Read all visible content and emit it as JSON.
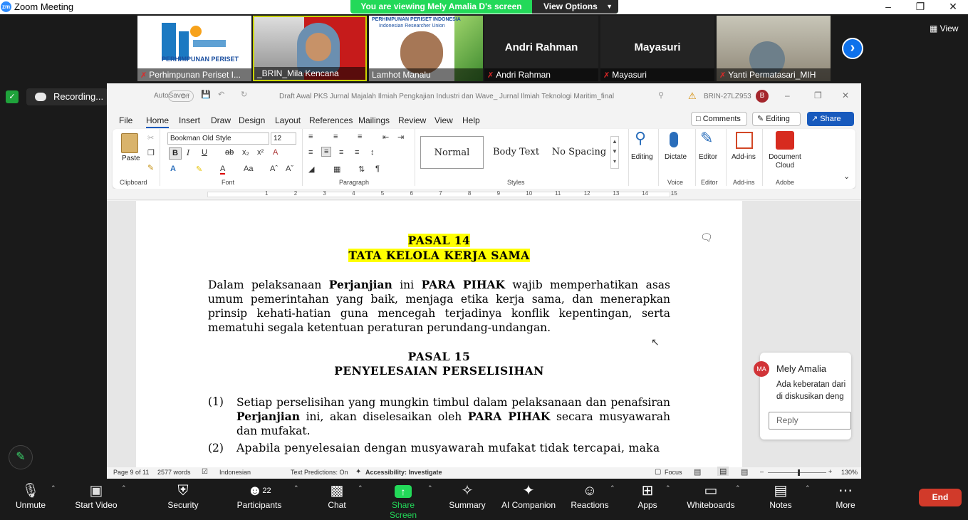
{
  "app": {
    "title": "Zoom Meeting",
    "logo": "zm"
  },
  "banner": {
    "message": "You are viewing Mely Amalia D's screen",
    "view_options": "View Options"
  },
  "gallery": {
    "view_label": "View",
    "tiles": [
      {
        "name": "Perhimpunan Periset I...",
        "logo_text": "PERHIMPUNAN PERISET"
      },
      {
        "name": "_BRIN_Mila Kencana"
      },
      {
        "name": "Lamhot Manalu",
        "logo_text": "PERHIMPUNAN PERISET INDONESIA",
        "logo_sub": "Indonesian Researcher Union"
      },
      {
        "name": "Andri Rahman",
        "big": "Andri Rahman"
      },
      {
        "name": "Mayasuri",
        "big": "Mayasuri"
      },
      {
        "name": "Yanti Permatasari_MIH"
      }
    ]
  },
  "recording": {
    "label": "Recording..."
  },
  "word": {
    "autosave": "AutoSave",
    "autosave_state": "Off",
    "doc_title": "Draft Awal PKS Jurnal Majalah Ilmiah Pengkajian Industri dan Wave_ Jurnal Ilmiah Teknologi Maritim_final",
    "user_id": "BRIN-27LZ953",
    "avatar": "B",
    "tabs": [
      "File",
      "Home",
      "Insert",
      "Draw",
      "Design",
      "Layout",
      "References",
      "Mailings",
      "Review",
      "View",
      "Help"
    ],
    "comments_btn": "Comments",
    "editing_btn": "Editing",
    "share_btn": "Share",
    "font_name": "Bookman Old Style",
    "font_size": "12",
    "groups": {
      "clipboard": "Clipboard",
      "font": "Font",
      "paragraph": "Paragraph",
      "styles": "Styles",
      "voice": "Voice",
      "editor": "Editor",
      "addins": "Add-ins",
      "adobe": "Adobe"
    },
    "paste": "Paste",
    "styles": [
      "Normal",
      "Body Text",
      "No Spacing"
    ],
    "editing": "Editing",
    "dictate": "Dictate",
    "editor": "Editor",
    "addins": "Add-ins",
    "doc_cloud": "Document Cloud",
    "ruler_nums": [
      "1",
      "2",
      "3",
      "4",
      "5",
      "6",
      "7",
      "8",
      "9",
      "10",
      "11",
      "12",
      "13",
      "14",
      "15"
    ],
    "doc": {
      "h1a": "PASAL 14",
      "h1b": "TATA KELOLA KERJA SAMA",
      "p1_a": "Dalam pelaksanaan ",
      "p1_b": "Perjanjian",
      "p1_c": " ini ",
      "p1_d": "PARA PIHAK",
      "p1_e": " wajib memperhatikan asas umum pemerintahan yang baik, menjaga etika kerja sama, dan menerapkan prinsip kehati-hatian guna mencegah terjadinya konflik kepentingan, serta mematuhi segala ketentuan peraturan perundang-undangan.",
      "h2a": "PASAL 15",
      "h2b": "PENYELESAIAN PERSELISIHAN",
      "i1_num": "(1)",
      "i1_a": "Setiap perselisihan yang mungkin timbul dalam pelaksanaan dan penafsiran ",
      "i1_b": "Perjanjian",
      "i1_c": " ini, akan diselesaikan oleh ",
      "i1_d": "PARA PIHAK",
      "i1_e": " secara musyawarah dan mufakat.",
      "i2_num": "(2)",
      "i2_a": "Apabila penyelesaian dengan musyawarah mufakat tidak tercapai, maka"
    },
    "comment": {
      "initials": "MA",
      "author": "Mely Amalia",
      "text": "Ada keberatan dari di diskusikan deng",
      "reply": "Reply"
    },
    "status": {
      "page": "Page 9 of 11",
      "words": "2577 words",
      "lang": "Indonesian",
      "predictions": "Text Predictions: On",
      "accessibility": "Accessibility: Investigate",
      "focus": "Focus",
      "zoom": "130%"
    }
  },
  "toolbar": {
    "unmute": "Unmute",
    "start_video": "Start Video",
    "security": "Security",
    "participants": "Participants",
    "participants_count": "22",
    "chat": "Chat",
    "share_screen": "Share Screen",
    "summary": "Summary",
    "ai_companion": "AI Companion",
    "reactions": "Reactions",
    "apps": "Apps",
    "whiteboards": "Whiteboards",
    "notes": "Notes",
    "more": "More",
    "end": "End"
  }
}
